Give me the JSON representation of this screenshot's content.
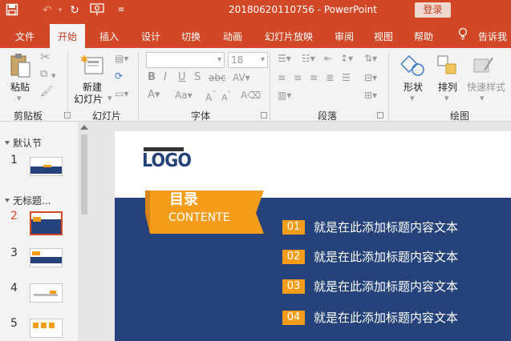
{
  "titlebar": {
    "doc_title": "20180620110756  -  PowerPoint",
    "login_label": "登录"
  },
  "tabs": [
    {
      "label": "文件",
      "active": false
    },
    {
      "label": "开始",
      "active": true
    },
    {
      "label": "插入",
      "active": false
    },
    {
      "label": "设计",
      "active": false
    },
    {
      "label": "切换",
      "active": false
    },
    {
      "label": "动画",
      "active": false
    },
    {
      "label": "幻灯片放映",
      "active": false
    },
    {
      "label": "审阅",
      "active": false
    },
    {
      "label": "视图",
      "active": false
    },
    {
      "label": "帮助",
      "active": false
    }
  ],
  "tell_me": "告诉我",
  "ribbon": {
    "groups": {
      "clipboard": "剪贴板",
      "slides": "幻灯片",
      "font": "字体",
      "paragraph": "段落",
      "drawing": "绘图"
    },
    "paste_label": "粘贴",
    "new_slide_line1": "新建",
    "new_slide_line2": "幻灯片",
    "font_size": "18",
    "shapes_label": "形状",
    "arrange_label": "排列",
    "quick_styles_label": "快速样式"
  },
  "sections": [
    {
      "label": "默认节"
    },
    {
      "label": "无标题..."
    }
  ],
  "slide_numbers": [
    "1",
    "2",
    "3",
    "4",
    "5"
  ],
  "slide": {
    "logo": "LOGO",
    "banner_title": "目录",
    "banner_subtitle": "CONTENTE",
    "items": [
      {
        "num": "01",
        "text": "就是在此添加标题内容文本"
      },
      {
        "num": "02",
        "text": "就是在此添加标题内容文本"
      },
      {
        "num": "03",
        "text": "就是在此添加标题内容文本"
      },
      {
        "num": "04",
        "text": "就是在此添加标题内容文本"
      }
    ]
  },
  "colors": {
    "accent": "#d24726",
    "slide_blue": "#25437a",
    "slide_orange": "#f59d1a"
  }
}
